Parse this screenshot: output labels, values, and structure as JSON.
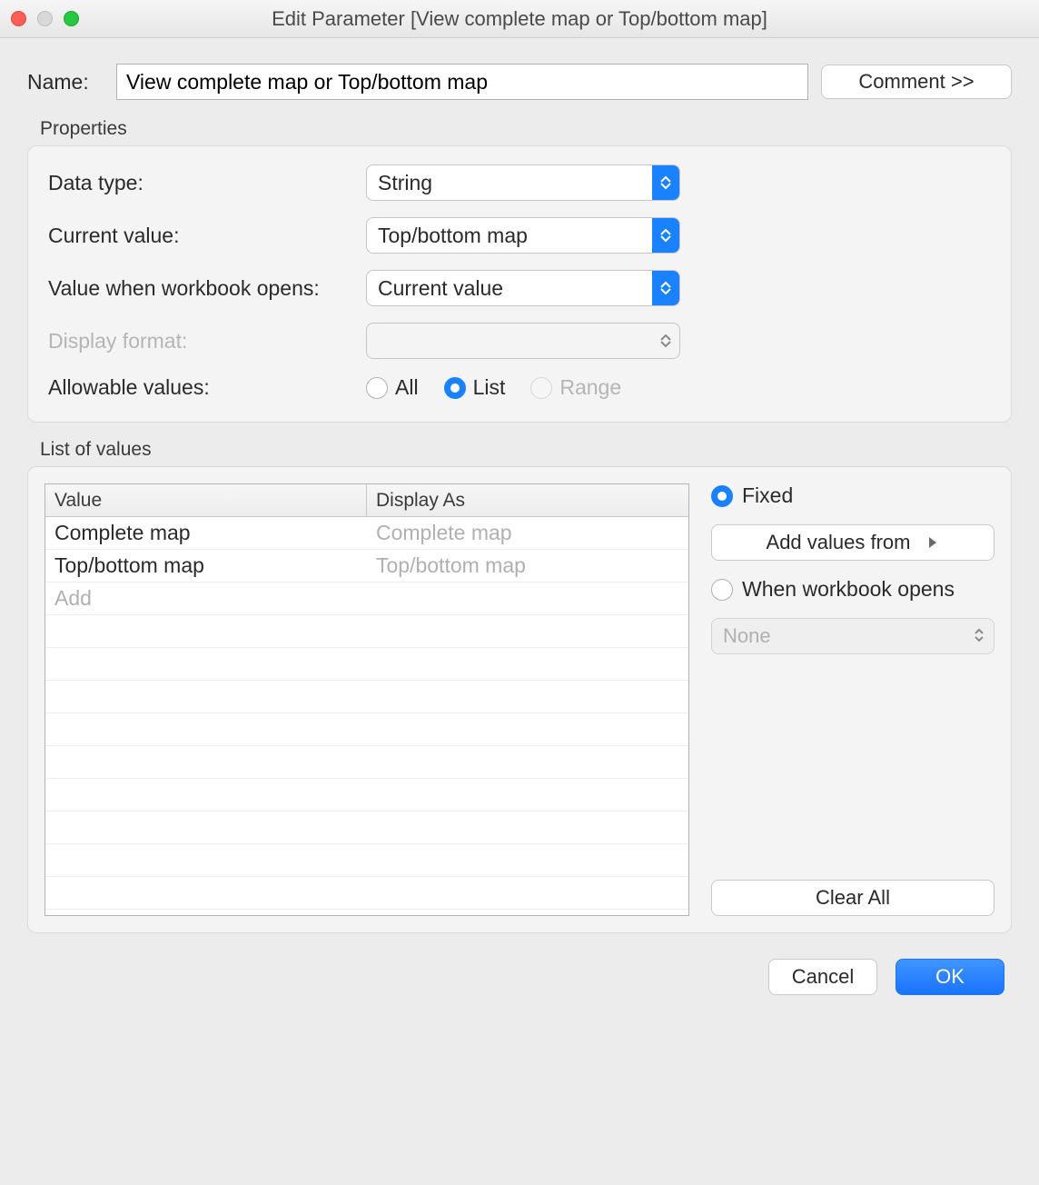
{
  "window": {
    "title": "Edit Parameter [View complete map or Top/bottom map]"
  },
  "name_row": {
    "label": "Name:",
    "value": "View complete map or Top/bottom map"
  },
  "buttons": {
    "comment": "Comment >>",
    "add_values": "Add values from",
    "clear_all": "Clear All",
    "cancel": "Cancel",
    "ok": "OK"
  },
  "groups": {
    "properties": "Properties",
    "list": "List of values"
  },
  "props": {
    "data_type": {
      "label": "Data type:",
      "value": "String"
    },
    "current_value": {
      "label": "Current value:",
      "value": "Top/bottom map"
    },
    "on_open": {
      "label": "Value when workbook opens:",
      "value": "Current value"
    },
    "display_format": {
      "label": "Display format:",
      "value": ""
    },
    "allowable": {
      "label": "Allowable values:",
      "all": "All",
      "list": "List",
      "range": "Range"
    }
  },
  "table": {
    "headers": {
      "value": "Value",
      "display_as": "Display As"
    },
    "rows": [
      {
        "value": "Complete map",
        "display_as": "Complete map"
      },
      {
        "value": "Top/bottom map",
        "display_as": "Top/bottom map"
      }
    ],
    "add_placeholder": "Add"
  },
  "side": {
    "fixed": "Fixed",
    "when_open": "When workbook opens",
    "none": "None"
  }
}
